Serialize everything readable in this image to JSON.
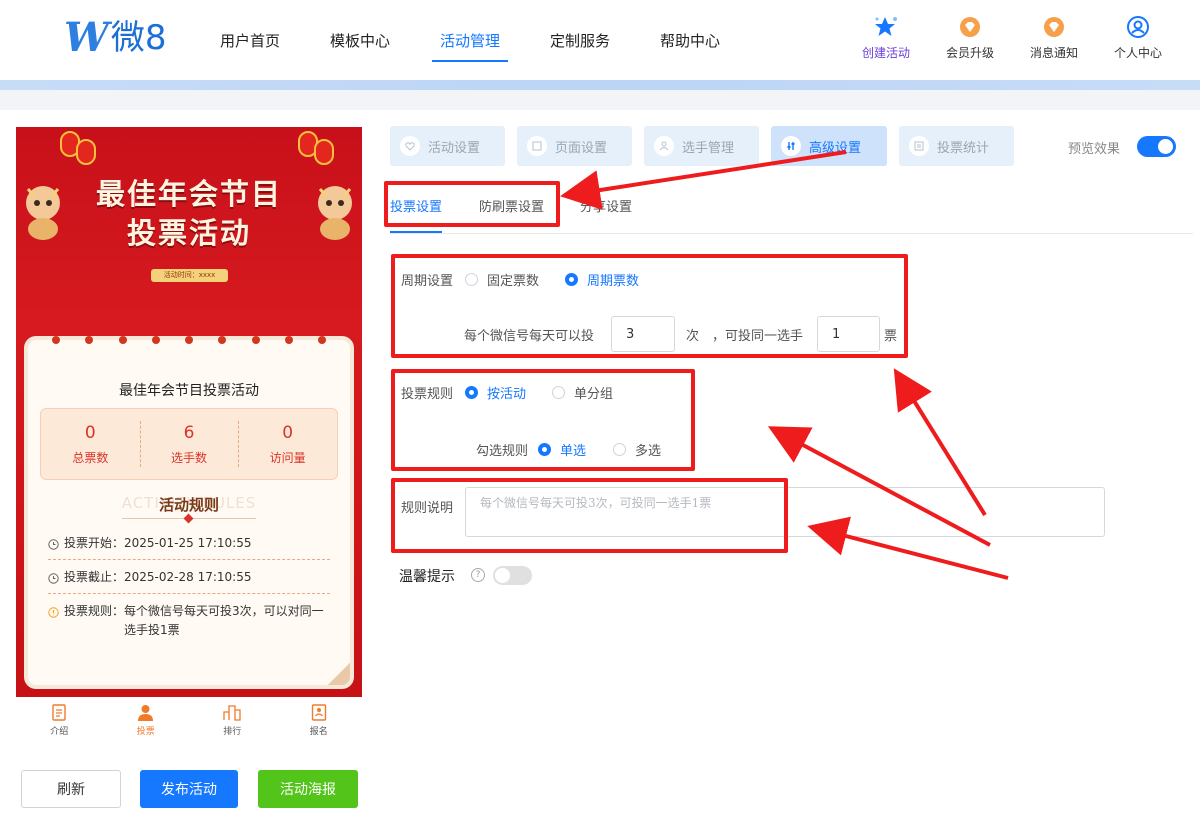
{
  "logo": {
    "mark": "W",
    "text": "微8"
  },
  "nav": [
    {
      "label": "用户首页",
      "active": false
    },
    {
      "label": "模板中心",
      "active": false
    },
    {
      "label": "活动管理",
      "active": true
    },
    {
      "label": "定制服务",
      "active": false
    },
    {
      "label": "帮助中心",
      "active": false
    }
  ],
  "top_icons": [
    {
      "label": "创建活动",
      "icon": "star-icon"
    },
    {
      "label": "会员升级",
      "icon": "diamond-icon"
    },
    {
      "label": "消息通知",
      "icon": "bell-icon"
    },
    {
      "label": "个人中心",
      "icon": "user-icon"
    }
  ],
  "preview": {
    "banner_title_line1": "最佳年会节目",
    "banner_title_line2": "投票活动",
    "banner_time": "活动时间：xxxx",
    "card_title": "最佳年会节目投票活动",
    "stats": [
      {
        "value": "0",
        "label": "总票数"
      },
      {
        "value": "6",
        "label": "选手数"
      },
      {
        "value": "0",
        "label": "访问量"
      }
    ],
    "rules_bg_text": "ACTIVITY RULES",
    "rules_title": "活动规则",
    "rule_start_key": "投票开始：",
    "rule_start_val": "2025-01-25 17:10:55",
    "rule_end_key": "投票截止：",
    "rule_end_val": "2025-02-28 17:10:55",
    "rule_rule_key": "投票规则：",
    "rule_rule_val": "每个微信号每天可投3次，可以对同一选手投1票",
    "bottom_nav": [
      {
        "label": "介绍",
        "active": false
      },
      {
        "label": "投票",
        "active": true
      },
      {
        "label": "排行",
        "active": false
      },
      {
        "label": "报名",
        "active": false
      }
    ]
  },
  "buttons": {
    "refresh": "刷新",
    "publish": "发布活动",
    "poster": "活动海报"
  },
  "colors": {
    "primary": "#1677ff",
    "green": "#52c41a",
    "festive_red": "#d61a1f",
    "highlight": "#ee1c1c"
  },
  "main_tabs": [
    {
      "label": "活动设置",
      "active": false
    },
    {
      "label": "页面设置",
      "active": false
    },
    {
      "label": "选手管理",
      "active": false
    },
    {
      "label": "高级设置",
      "active": true
    },
    {
      "label": "投票统计",
      "active": false
    }
  ],
  "preview_toggle": {
    "label": "预览效果",
    "on": true
  },
  "sub_tabs": [
    {
      "label": "投票设置",
      "active": true
    },
    {
      "label": "防刷票设置",
      "active": false
    },
    {
      "label": "分享设置",
      "active": false
    }
  ],
  "period": {
    "label": "周期设置",
    "option_fixed": "固定票数",
    "option_cycle": "周期票数",
    "selected": "周期票数",
    "prefix": "每个微信号每天可以投",
    "times_value": "3",
    "times_unit": "次",
    "mid": "，可投同一选手",
    "per_player_value": "1",
    "per_player_unit": "票"
  },
  "vote_rule": {
    "label": "投票规则",
    "option_activity": "按活动",
    "option_group": "单分组",
    "selected": "按活动",
    "select_label": "勾选规则",
    "option_single": "单选",
    "option_multi": "多选",
    "select_selected": "单选"
  },
  "rule_desc": {
    "label": "规则说明",
    "placeholder": "每个微信号每天可投3次，可投同一选手1票"
  },
  "warm_tip": {
    "label": "温馨提示",
    "on": false
  }
}
